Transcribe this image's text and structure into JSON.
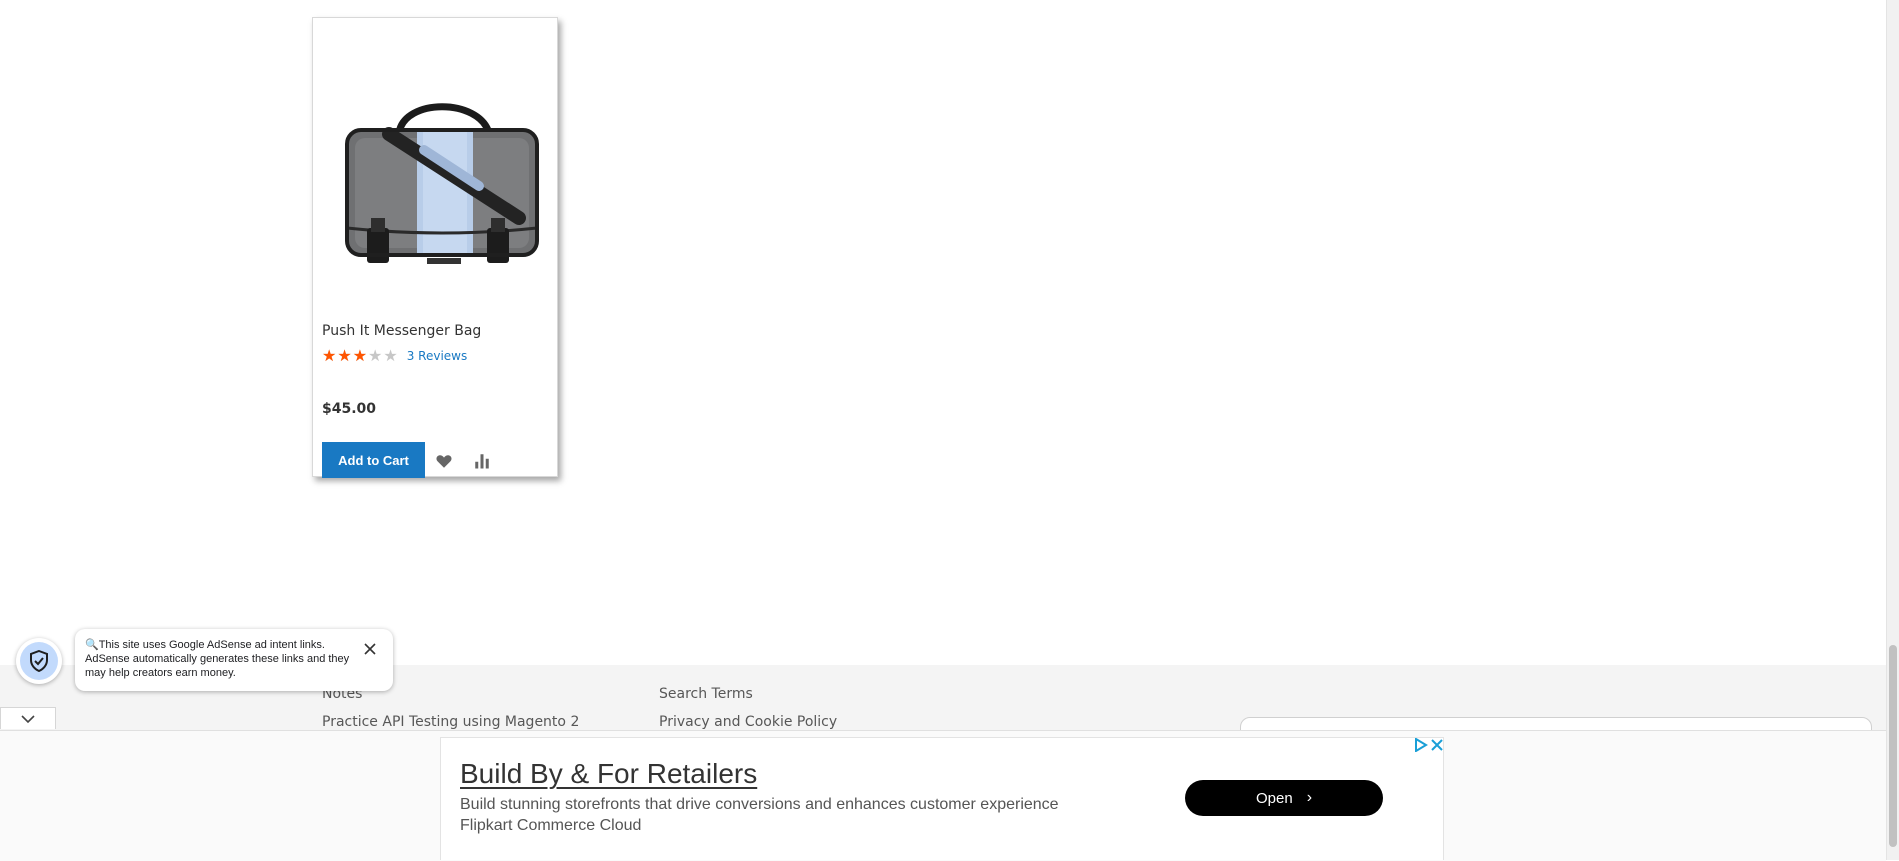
{
  "product": {
    "name": "Push It Messenger Bag",
    "rating_fraction": 0.6,
    "stars_glyphs": "★★★★★",
    "reviews": "3 Reviews",
    "price": "$45.00",
    "add_to_cart": "Add to Cart"
  },
  "footer": {
    "links": [
      "Notes",
      "Practice API Testing using Magento 2",
      "Search Terms",
      "Privacy and Cookie Policy"
    ]
  },
  "adsense_notice": {
    "text": "🔍This site uses Google AdSense ad intent links. AdSense automatically generates these links and they may help creators earn money."
  },
  "ad": {
    "title": "Build By & For Retailers",
    "description": "Build stunning storefronts that drive conversions and enhances customer experience",
    "advertiser": "Flipkart Commerce Cloud",
    "cta": "Open",
    "cta_icon": "chevron-right-icon"
  },
  "colors": {
    "accent": "#1979c3",
    "star": "#ff5501",
    "ad_button": "#000000"
  }
}
